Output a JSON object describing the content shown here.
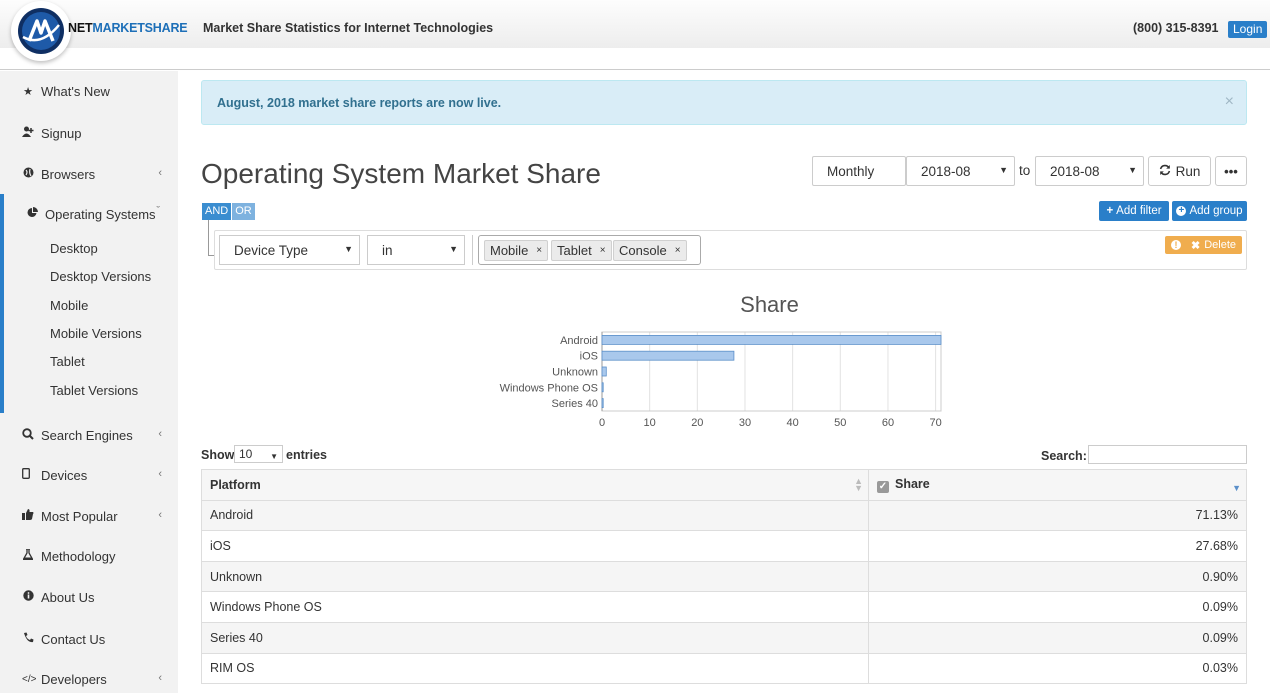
{
  "header": {
    "brand_part1": "NET",
    "brand_part2": "MARKETSHARE",
    "tagline": "Market Share Statistics for Internet Technologies",
    "phone": "(800) 315-8391",
    "login_label": "Login",
    "accent_color": "#2a7fc9"
  },
  "sidebar": {
    "items": [
      {
        "label": "What's New",
        "icon": "star-icon"
      },
      {
        "label": "Signup",
        "icon": "user-plus-icon"
      },
      {
        "label": "Browsers",
        "icon": "globe-icon"
      },
      {
        "label": "Operating Systems",
        "icon": "pie-chart-icon"
      },
      {
        "label": "Search Engines",
        "icon": "search-icon"
      },
      {
        "label": "Devices",
        "icon": "tablet-icon"
      },
      {
        "label": "Most Popular",
        "icon": "thumbs-up-icon"
      },
      {
        "label": "Methodology",
        "icon": "flask-icon"
      },
      {
        "label": "About Us",
        "icon": "info-icon"
      },
      {
        "label": "Contact Us",
        "icon": "phone-icon"
      },
      {
        "label": "Developers",
        "icon": "code-icon"
      }
    ],
    "subitems": [
      "Desktop",
      "Desktop Versions",
      "Mobile",
      "Mobile Versions",
      "Tablet",
      "Tablet Versions"
    ]
  },
  "alert": {
    "text": "August, 2018 market share reports are now live.",
    "close": "×"
  },
  "main": {
    "title": "Operating System Market Share",
    "period": "Monthly",
    "from": "2018-08",
    "to_label": "to",
    "to": "2018-08",
    "run_label": "Run",
    "more_label": "•••"
  },
  "query": {
    "and_label": "AND",
    "or_label": "OR",
    "add_filter_label": "Add filter",
    "add_group_label": "Add group",
    "field": "Device Type",
    "operator": "in",
    "tags": [
      "Mobile",
      "Tablet",
      "Console"
    ],
    "delete_label": "Delete"
  },
  "chart_data": {
    "type": "bar",
    "orientation": "horizontal",
    "title": "Share",
    "categories": [
      "Android",
      "iOS",
      "Unknown",
      "Windows Phone OS",
      "Series 40"
    ],
    "values": [
      71.13,
      27.68,
      0.9,
      0.09,
      0.09
    ],
    "xlim": [
      0,
      71.13
    ],
    "xticks": [
      0,
      10,
      20,
      30,
      40,
      50,
      60,
      70
    ],
    "grid": true,
    "bar_color": "#a9c8ec"
  },
  "table": {
    "show_label": "Show",
    "entries_value": "10",
    "entries_label": "entries",
    "search_label": "Search:",
    "columns": [
      "Platform",
      "Share"
    ],
    "rows": [
      {
        "platform": "Android",
        "share": "71.13%"
      },
      {
        "platform": "iOS",
        "share": "27.68%"
      },
      {
        "platform": "Unknown",
        "share": "0.90%"
      },
      {
        "platform": "Windows Phone OS",
        "share": "0.09%"
      },
      {
        "platform": "Series 40",
        "share": "0.09%"
      },
      {
        "platform": "RIM OS",
        "share": "0.03%"
      }
    ]
  }
}
